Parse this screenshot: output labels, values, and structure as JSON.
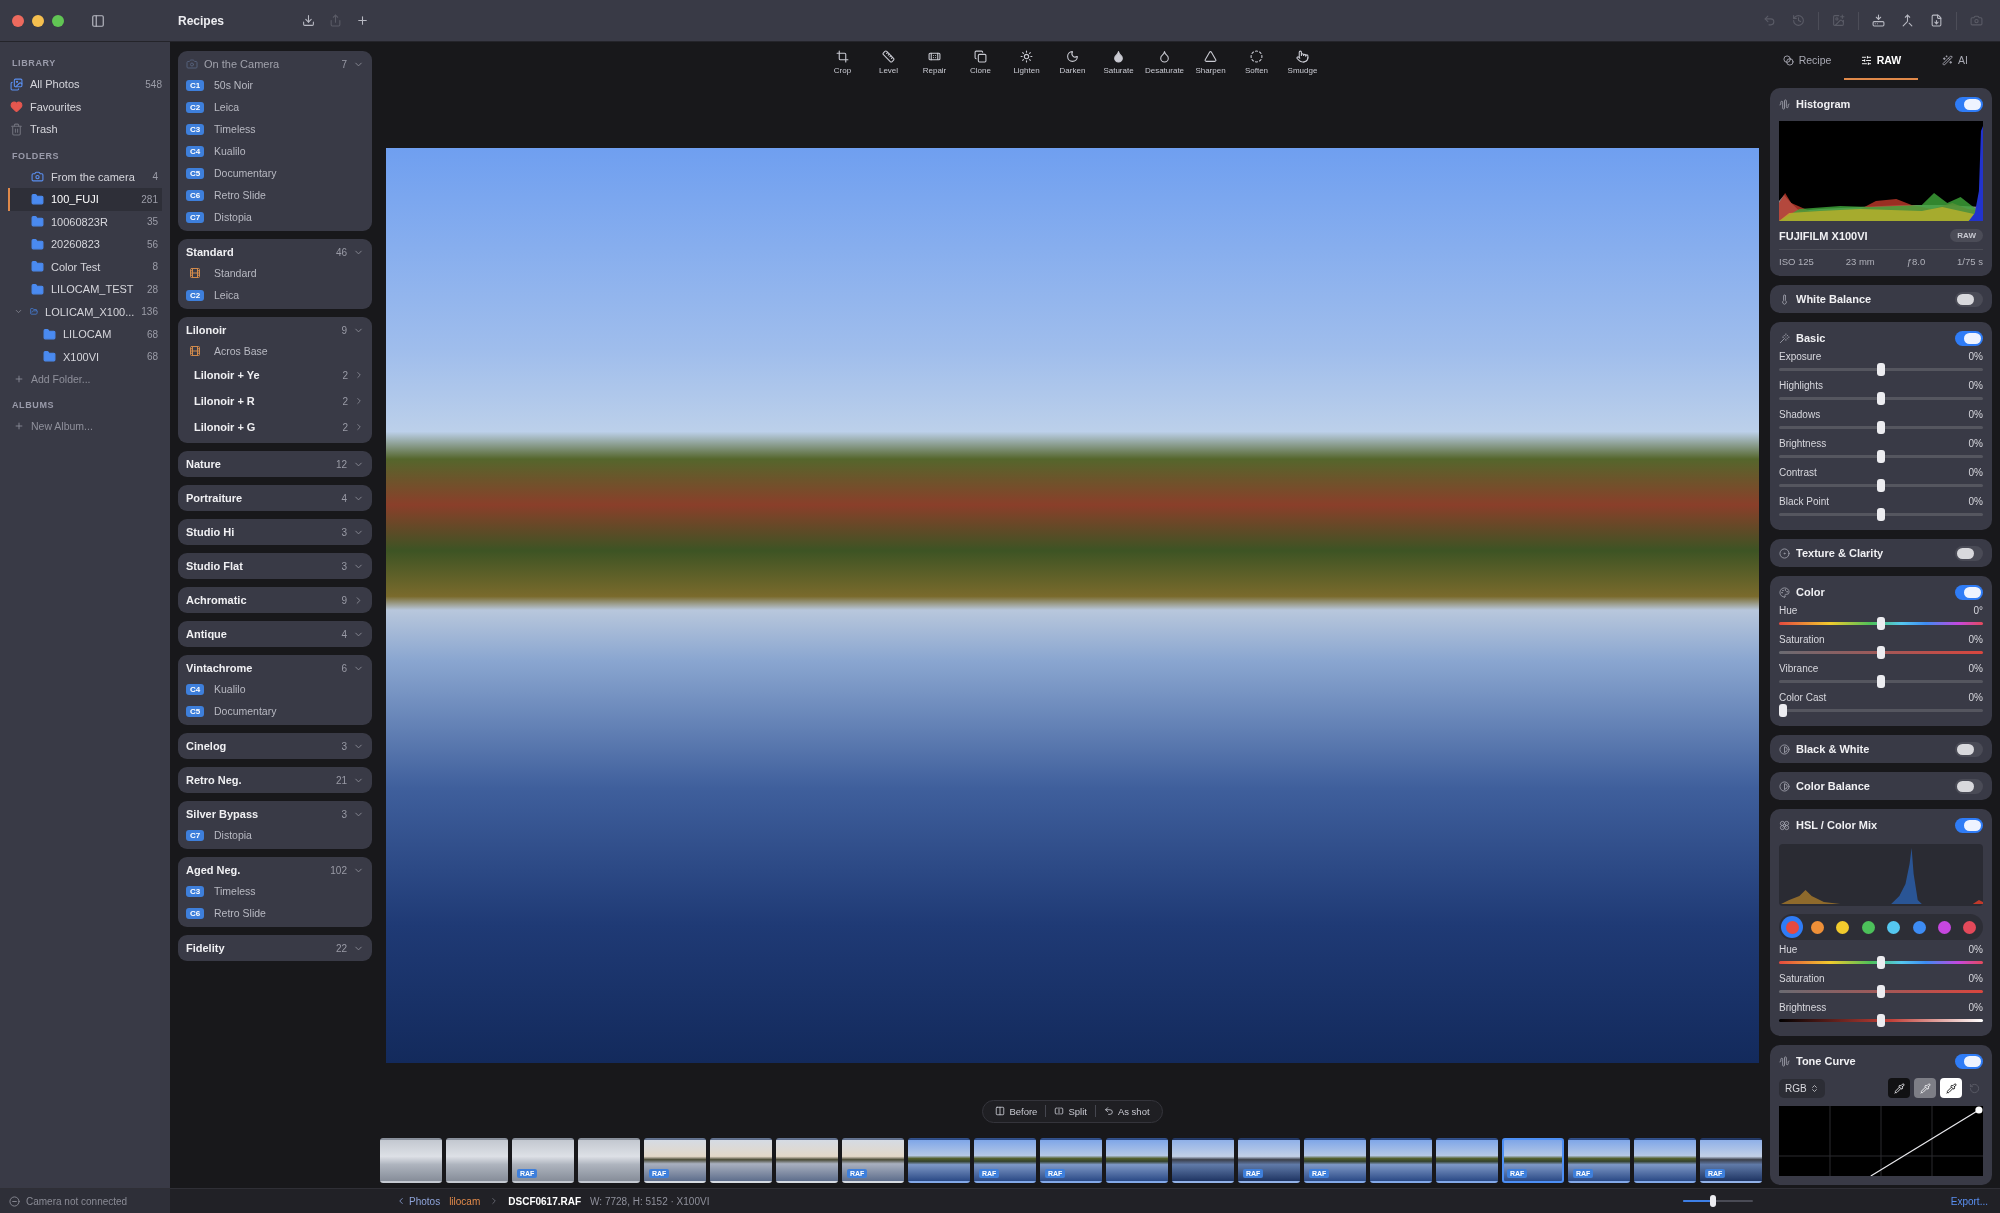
{
  "window": {
    "title": "Recipes"
  },
  "title_actions": [
    {
      "kind": "import",
      "disabled": false
    },
    {
      "kind": "share",
      "disabled": true
    },
    {
      "kind": "add",
      "disabled": false
    }
  ],
  "window_actions": [
    {
      "kind": "undo",
      "disabled": true
    },
    {
      "kind": "history",
      "disabled": true
    },
    {
      "kind": "image",
      "disabled": true
    },
    {
      "kind": "tray",
      "disabled": false
    },
    {
      "kind": "merge",
      "disabled": false
    },
    {
      "kind": "file",
      "disabled": false
    },
    {
      "kind": "camera",
      "disabled": true
    }
  ],
  "sidebar": {
    "sections": [
      {
        "heading": "LIBRARY",
        "items": [
          {
            "kind": "photos",
            "label": "All Photos",
            "count": "548",
            "selected": false
          },
          {
            "kind": "heart",
            "label": "Favourites",
            "selected": false
          },
          {
            "kind": "trash",
            "label": "Trash",
            "selected": false
          }
        ]
      },
      {
        "heading": "FOLDERS",
        "items": [
          {
            "kind": "camera",
            "label": "From the camera",
            "count": "4",
            "selected": false
          },
          {
            "kind": "folder",
            "label": "100_FUJI",
            "count": "281",
            "selected": true
          },
          {
            "kind": "folder",
            "label": "10060823R",
            "count": "35",
            "selected": false
          },
          {
            "kind": "folder",
            "label": "20260823",
            "count": "56",
            "selected": false
          },
          {
            "kind": "folder",
            "label": "Color Test",
            "count": "8",
            "selected": false
          },
          {
            "kind": "folder",
            "label": "LILOCAM_TEST",
            "count": "28",
            "selected": false
          },
          {
            "kind": "open_folder",
            "label": "LOLICAM_X100...",
            "count": "136",
            "selected": false,
            "expanded": true,
            "children": [
              {
                "kind": "folder",
                "label": "LILOCAM",
                "count": "68",
                "selected": false
              },
              {
                "kind": "folder",
                "label": "X100VI",
                "count": "68",
                "selected": false
              }
            ]
          }
        ],
        "add": "Add Folder..."
      },
      {
        "heading": "ALBUMS",
        "add": "New Album..."
      }
    ]
  },
  "recipes": {
    "groups": [
      {
        "kind": "camera",
        "title": "On the Camera",
        "count": "7",
        "expanded": true,
        "items": [
          {
            "kind": "badge",
            "badge": "C1",
            "label": "50s Noir"
          },
          {
            "kind": "badge",
            "badge": "C2",
            "label": "Leica"
          },
          {
            "kind": "badge",
            "badge": "C3",
            "label": "Timeless"
          },
          {
            "kind": "badge",
            "badge": "C4",
            "label": "Kualilo"
          },
          {
            "kind": "badge",
            "badge": "C5",
            "label": "Documentary"
          },
          {
            "kind": "badge",
            "badge": "C6",
            "label": "Retro Slide"
          },
          {
            "kind": "badge",
            "badge": "C7",
            "label": "Distopia"
          }
        ]
      },
      {
        "kind": "group",
        "title": "Standard",
        "count": "46",
        "expanded": true,
        "items": [
          {
            "kind": "film",
            "label": "Standard"
          },
          {
            "kind": "badge",
            "badge": "C2",
            "label": "Leica"
          }
        ]
      },
      {
        "kind": "group",
        "title": "Lilonoir",
        "count": "9",
        "expanded": true,
        "items": [
          {
            "kind": "film",
            "label": "Acros Base"
          }
        ],
        "subgroups": [
          {
            "title": "Lilonoir + Ye",
            "count": "2"
          },
          {
            "title": "Lilonoir + R",
            "count": "2"
          },
          {
            "title": "Lilonoir + G",
            "count": "2"
          }
        ]
      },
      {
        "kind": "group",
        "title": "Nature",
        "count": "12",
        "expanded": true
      },
      {
        "kind": "group",
        "title": "Portraiture",
        "count": "4",
        "expanded": true
      },
      {
        "kind": "group",
        "title": "Studio Hi",
        "count": "3",
        "expanded": true
      },
      {
        "kind": "group",
        "title": "Studio Flat",
        "count": "3",
        "expanded": true
      },
      {
        "kind": "group",
        "title": "Achromatic",
        "count": "9",
        "expanded": false
      },
      {
        "kind": "group",
        "title": "Antique",
        "count": "4",
        "expanded": true
      },
      {
        "kind": "group",
        "title": "Vintachrome",
        "count": "6",
        "expanded": true,
        "items": [
          {
            "kind": "badge",
            "badge": "C4",
            "label": "Kualilo"
          },
          {
            "kind": "badge",
            "badge": "C5",
            "label": "Documentary"
          }
        ]
      },
      {
        "kind": "group",
        "title": "Cinelog",
        "count": "3",
        "expanded": true
      },
      {
        "kind": "group",
        "title": "Retro Neg.",
        "count": "21",
        "expanded": true
      },
      {
        "kind": "group",
        "title": "Silver Bypass",
        "count": "3",
        "expanded": true,
        "items": [
          {
            "kind": "badge",
            "badge": "C7",
            "label": "Distopia"
          }
        ]
      },
      {
        "kind": "group",
        "title": "Aged Neg.",
        "count": "102",
        "expanded": true,
        "items": [
          {
            "kind": "badge",
            "badge": "C3",
            "label": "Timeless"
          },
          {
            "kind": "badge",
            "badge": "C6",
            "label": "Retro Slide"
          }
        ]
      },
      {
        "kind": "group",
        "title": "Fidelity",
        "count": "22",
        "expanded": true
      }
    ]
  },
  "tools": [
    {
      "kind": "crop",
      "label": "Crop"
    },
    {
      "kind": "level",
      "label": "Level"
    },
    {
      "kind": "repair",
      "label": "Repair"
    },
    {
      "kind": "clone",
      "label": "Clone"
    },
    {
      "kind": "lighten",
      "label": "Lighten"
    },
    {
      "kind": "darken",
      "label": "Darken"
    },
    {
      "kind": "saturate",
      "label": "Saturate"
    },
    {
      "kind": "desaturate",
      "label": "Desaturate"
    },
    {
      "kind": "sharpen",
      "label": "Sharpen"
    },
    {
      "kind": "soften",
      "label": "Soften"
    },
    {
      "kind": "smudge",
      "label": "Smudge"
    }
  ],
  "view_modes": [
    {
      "kind": "before",
      "label": "Before"
    },
    {
      "kind": "split",
      "label": "Split"
    },
    {
      "kind": "as_shot",
      "label": "As shot"
    }
  ],
  "filmstrip": [
    {
      "kind": "frost",
      "selected": false
    },
    {
      "kind": "frost",
      "selected": false
    },
    {
      "kind": "frost",
      "badge": "RAF",
      "selected": false
    },
    {
      "kind": "frost",
      "selected": false
    },
    {
      "kind": "dawn",
      "badge": "RAF",
      "selected": false
    },
    {
      "kind": "dawn",
      "selected": false
    },
    {
      "kind": "dawn",
      "selected": false
    },
    {
      "kind": "dawn",
      "badge": "RAF",
      "selected": false
    },
    {
      "kind": "lake",
      "selected": false
    },
    {
      "kind": "lake",
      "badge": "RAF",
      "selected": false
    },
    {
      "kind": "lake",
      "badge": "RAF",
      "selected": false
    },
    {
      "kind": "lake",
      "selected": false
    },
    {
      "kind": "dock",
      "selected": false
    },
    {
      "kind": "dock",
      "badge": "RAF",
      "selected": false
    },
    {
      "kind": "lake",
      "badge": "RAF",
      "selected": false
    },
    {
      "kind": "lake",
      "selected": false
    },
    {
      "kind": "lake",
      "selected": false
    },
    {
      "kind": "lake",
      "badge": "RAF",
      "selected": true
    },
    {
      "kind": "lake",
      "badge": "RAF",
      "selected": false
    },
    {
      "kind": "lake",
      "selected": false
    },
    {
      "kind": "dock",
      "badge": "RAF",
      "selected": false
    }
  ],
  "adjustments": {
    "tabs": [
      {
        "kind": "recipe",
        "label": "Recipe",
        "selected": false
      },
      {
        "kind": "raw",
        "label": "RAW",
        "selected": true
      },
      {
        "kind": "ai",
        "label": "AI",
        "selected": false
      }
    ],
    "sections": [
      {
        "kind": "histogram",
        "title": "Histogram",
        "on": true,
        "camera": "FUJIFILM X100VI",
        "format": "RAW",
        "exif": [
          "ISO 125",
          "23 mm",
          "ƒ8.0",
          "1/75 s"
        ]
      },
      {
        "kind": "white_balance",
        "title": "White Balance",
        "on": false
      },
      {
        "kind": "basic",
        "title": "Basic",
        "on": true,
        "sliders": [
          {
            "kind": "plain",
            "label": "Exposure",
            "value": "0%",
            "level": 0.5
          },
          {
            "kind": "plain",
            "label": "Highlights",
            "value": "0%",
            "level": 0.5
          },
          {
            "kind": "plain",
            "label": "Shadows",
            "value": "0%",
            "level": 0.5
          },
          {
            "kind": "plain",
            "label": "Brightness",
            "value": "0%",
            "level": 0.5
          },
          {
            "kind": "plain",
            "label": "Contrast",
            "value": "0%",
            "level": 0.5
          },
          {
            "kind": "plain",
            "label": "Black Point",
            "value": "0%",
            "level": 0.5
          }
        ]
      },
      {
        "kind": "texture",
        "title": "Texture & Clarity",
        "on": false
      },
      {
        "kind": "color",
        "title": "Color",
        "on": true,
        "sliders": [
          {
            "kind": "hue",
            "label": "Hue",
            "value": "0°",
            "level": 0.5
          },
          {
            "kind": "saturation",
            "label": "Saturation",
            "value": "0%",
            "level": 0.5
          },
          {
            "kind": "plain",
            "label": "Vibrance",
            "value": "0%",
            "level": 0.5
          },
          {
            "kind": "plain",
            "label": "Color Cast",
            "value": "0%",
            "level": 0
          }
        ]
      },
      {
        "kind": "black_white",
        "title": "Black & White",
        "on": false
      },
      {
        "kind": "color_balance",
        "title": "Color Balance",
        "on": false
      },
      {
        "kind": "hsl",
        "title": "HSL / Color Mix",
        "on": true,
        "swatches": [
          {
            "color": "#e5493f",
            "selected": true
          },
          {
            "color": "#ef9038",
            "selected": false
          },
          {
            "color": "#f2cb2d",
            "selected": false
          },
          {
            "color": "#4cc15a",
            "selected": false
          },
          {
            "color": "#55c8f0",
            "selected": false
          },
          {
            "color": "#3d8cf4",
            "selected": false
          },
          {
            "color": "#c647df",
            "selected": false
          },
          {
            "color": "#e4495a",
            "selected": false
          }
        ],
        "sliders": [
          {
            "kind": "hue",
            "label": "Hue",
            "value": "0%",
            "level": 0.5
          },
          {
            "kind": "saturation",
            "label": "Saturation",
            "value": "0%",
            "level": 0.5
          },
          {
            "kind": "brightness",
            "label": "Brightness",
            "value": "0%",
            "level": 0.5
          }
        ]
      },
      {
        "kind": "tone_curve",
        "title": "Tone Curve",
        "on": true,
        "channel": "RGB",
        "pickers": [
          {
            "kind": "black"
          },
          {
            "kind": "grey"
          },
          {
            "kind": "white"
          }
        ]
      }
    ]
  },
  "status_bar": {
    "camera": "Camera not connected",
    "breadcrumb": [
      {
        "kind": "back",
        "label": "Photos"
      },
      {
        "kind": "folder",
        "label": "lilocam"
      },
      {
        "kind": "file",
        "label": "DSCF0617.RAF"
      }
    ],
    "info": "W: 7728, H: 5152 · X100VI",
    "zoom": {
      "level": 0.42
    },
    "export": "Export..."
  }
}
